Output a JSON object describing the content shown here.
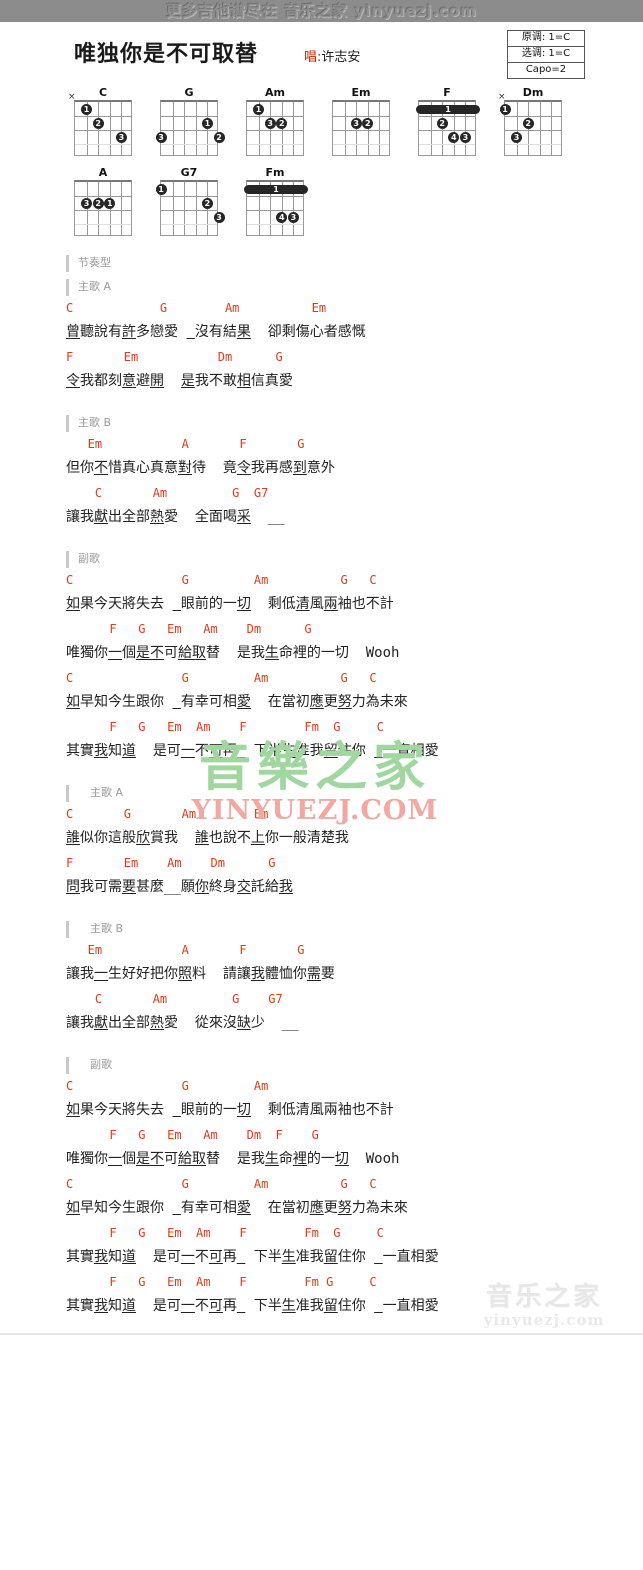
{
  "banner": {
    "text": "更多吉他谱尽在  音乐之家 yinyuezj.com"
  },
  "header": {
    "title": "唯独你是不可取替",
    "singer_label": "唱:",
    "singer_name": "许志安",
    "key_info": [
      {
        "label": "原调: 1=C"
      },
      {
        "label": "选调: 1=C"
      },
      {
        "label": "Capo=2"
      }
    ]
  },
  "chord_rows": [
    [
      {
        "name": "C",
        "mute": true,
        "barre": null,
        "dots": [
          {
            "s": 1,
            "f": 1,
            "n": "1"
          },
          {
            "s": 2,
            "f": 2,
            "n": "2"
          },
          {
            "s": 4,
            "f": 3,
            "n": "3"
          }
        ]
      },
      {
        "name": "G",
        "mute": false,
        "barre": null,
        "dots": [
          {
            "s": 4,
            "f": 2,
            "n": "1"
          },
          {
            "s": 5,
            "f": 3,
            "n": "2"
          },
          {
            "s": 0,
            "f": 3,
            "n": "3"
          }
        ]
      },
      {
        "name": "Am",
        "mute": false,
        "barre": null,
        "dots": [
          {
            "s": 1,
            "f": 1,
            "n": "1"
          },
          {
            "s": 3,
            "f": 2,
            "n": "2"
          },
          {
            "s": 2,
            "f": 2,
            "n": "3"
          }
        ]
      },
      {
        "name": "Em",
        "mute": false,
        "barre": null,
        "dots": [
          {
            "s": 3,
            "f": 2,
            "n": "2"
          },
          {
            "s": 2,
            "f": 2,
            "n": "3"
          }
        ]
      },
      {
        "name": "F",
        "mute": false,
        "barre": {
          "f": 1,
          "n": "1"
        },
        "dots": [
          {
            "s": 2,
            "f": 2,
            "n": "2"
          },
          {
            "s": 4,
            "f": 3,
            "n": "3"
          },
          {
            "s": 3,
            "f": 3,
            "n": "4"
          }
        ]
      },
      {
        "name": "Dm",
        "mute": true,
        "barre": null,
        "dots": [
          {
            "s": 0,
            "f": 1,
            "n": "1"
          },
          {
            "s": 2,
            "f": 2,
            "n": "2"
          },
          {
            "s": 1,
            "f": 3,
            "n": "3"
          }
        ]
      }
    ],
    [
      {
        "name": "A",
        "mute": false,
        "barre": null,
        "dots": [
          {
            "s": 3,
            "f": 2,
            "n": "1"
          },
          {
            "s": 2,
            "f": 2,
            "n": "2"
          },
          {
            "s": 1,
            "f": 2,
            "n": "3"
          }
        ]
      },
      {
        "name": "G7",
        "mute": false,
        "barre": null,
        "dots": [
          {
            "s": 0,
            "f": 1,
            "n": "1"
          },
          {
            "s": 4,
            "f": 2,
            "n": "2"
          },
          {
            "s": 5,
            "f": 3,
            "n": "3"
          }
        ]
      },
      {
        "name": "Fm",
        "mute": false,
        "barre": {
          "f": 1,
          "n": "1"
        },
        "dots": [
          {
            "s": 4,
            "f": 3,
            "n": "3"
          },
          {
            "s": 3,
            "f": 3,
            "n": "4"
          }
        ]
      }
    ]
  ],
  "sections": [
    {
      "head": "节奏型",
      "indent": false,
      "lines": []
    },
    {
      "head": "主歌 A",
      "indent": false,
      "lines": [
        {
          "chords": "C            G        Am          Em",
          "lyrics": "曾聽說有許多戀愛  沒有結果  卻剩傷心者感慨",
          "underline": [
            0,
            4,
            9,
            13
          ]
        },
        {
          "chords": "F       Em           Dm      G",
          "lyrics": "令我都刻意避開  是我不敢相信真愛",
          "underline": [
            0,
            4,
            6,
            9,
            13
          ]
        }
      ]
    },
    {
      "head": "主歌 B",
      "indent": false,
      "lines": [
        {
          "chords": "   Em           A       F       G",
          "lyrics": "但你不惜真心真意對待  竟令我再感到意外",
          "underline": [
            2,
            8,
            13,
            17
          ]
        },
        {
          "chords": "    C       Am         G  G7",
          "lyrics": "讓我獻出全部熱愛  全面喝采  __",
          "underline": [
            2,
            6,
            13
          ]
        }
      ]
    },
    {
      "head": "副歌",
      "indent": false,
      "lines": [
        {
          "chords": "C               G         Am          G   C",
          "lyrics": "如果今天將失去  眼前的一切  剩低清風兩袖也不計",
          "underline": [
            0,
            8,
            13,
            18,
            20
          ]
        },
        {
          "chords": "      F   G   Em   Am    Dm      G",
          "lyrics": "唯獨你一個是不可給取替  是我生命裡的一切  Wooh",
          "underline": [
            3,
            5,
            6,
            8,
            9,
            15
          ]
        },
        {
          "chords": "C               G         Am          G   C",
          "lyrics": "如早知今生跟你  有幸可相愛  在當初應更努力為未來",
          "underline": [
            0,
            8,
            13,
            19,
            21
          ]
        },
        {
          "chords": "      F   G   Em  Am    F        Fm  G     C",
          "lyrics": "其實我知道  是可一不可再  下半生准我留住你  一直相愛",
          "underline": [
            2,
            4,
            9,
            11,
            13,
            17,
            20,
            24
          ]
        }
      ]
    },
    {
      "head": "主歌 A",
      "indent": true,
      "lines": [
        {
          "chords": "C       G       Am        Em",
          "lyrics": "誰似你這般欣賞我  誰也說不上你一般清楚我",
          "underline": [
            0,
            5,
            10,
            14
          ]
        },
        {
          "chords": "F       Em    Am    Dm      G",
          "lyrics": "問我可需要甚麼__願你終身交託給我",
          "underline": [
            0,
            4,
            10,
            13,
            16
          ]
        }
      ]
    },
    {
      "head": "主歌 B",
      "indent": true,
      "lines": [
        {
          "chords": "   Em           A       F       G",
          "lyrics": "讓我一生好好把你照料  請讓我體恤你需要",
          "underline": [
            2,
            8,
            14,
            18
          ]
        },
        {
          "chords": "    C       Am         G    G7",
          "lyrics": "讓我獻出全部熱愛  從來沒缺少  __",
          "underline": [
            2,
            6,
            13
          ]
        }
      ]
    },
    {
      "head": "副歌",
      "indent": true,
      "lines": [
        {
          "chords": "C               G         Am",
          "lyrics": "如果今天將失去  眼前的一切  剩低清風兩袖也不計",
          "underline": [
            0,
            8,
            13
          ]
        },
        {
          "chords": "      F   G   Em   Am    Dm  F    G",
          "lyrics": "唯獨你一個是不可給取替  是我生命裡的一切  Wooh",
          "underline": [
            3,
            5,
            6,
            8,
            9,
            15,
            17,
            20
          ]
        },
        {
          "chords": "C               G         Am          G   C",
          "lyrics": "如早知今生跟你  有幸可相愛  在當初應更努力為未來",
          "underline": [
            0,
            8,
            13,
            19,
            21
          ]
        },
        {
          "chords": "      F   G   Em  Am    F        Fm  G     C",
          "lyrics": "其實我知道  是可一不可再  下半生准我留住你  一直相愛",
          "underline": [
            2,
            4,
            9,
            11,
            13,
            17,
            20,
            24
          ]
        },
        {
          "chords": "      F   G   Em  Am    F        Fm G     C",
          "lyrics": "其實我知道  是可一不可再  下半生准我留住你  一直相愛",
          "underline": [
            2,
            4,
            9,
            11,
            13,
            17,
            20,
            24
          ]
        }
      ]
    }
  ],
  "watermark_mid": {
    "cn": "音樂之家",
    "en": "YINYUEZJ.COM"
  },
  "watermark_bottom": {
    "cn": "音乐之家",
    "en": "yinyuezj.com"
  }
}
